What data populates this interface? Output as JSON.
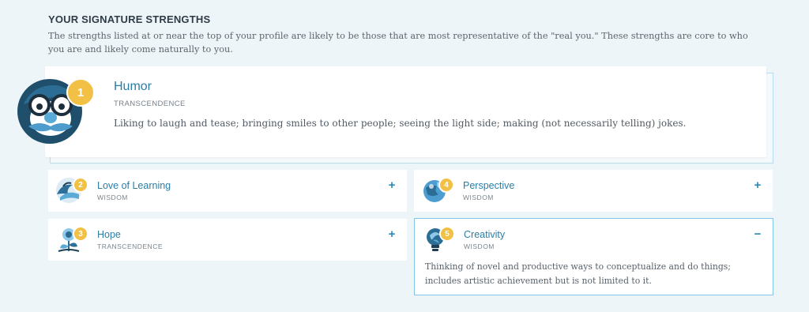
{
  "section": {
    "heading": "YOUR SIGNATURE STRENGTHS",
    "intro": "The strengths listed at or near the top of your profile are likely to be those that are most representative of the \"real you.\" These strengths are core to who you are and likely come naturally to you."
  },
  "featured": {
    "rank": "1",
    "title": "Humor",
    "category": "TRANSCENDENCE",
    "description": "Liking to laugh and tease; bringing smiles to other people; seeing the light side; making (not necessarily telling) jokes.",
    "icon": "glasses-mustache-face-icon"
  },
  "cards": [
    {
      "rank": "2",
      "title": "Love of Learning",
      "category": "WISDOM",
      "toggle": "+",
      "icon": "wave-book-icon"
    },
    {
      "rank": "4",
      "title": "Perspective",
      "category": "WISDOM",
      "toggle": "+",
      "icon": "globe-icon"
    },
    {
      "rank": "3",
      "title": "Hope",
      "category": "TRANSCENDENCE",
      "toggle": "+",
      "icon": "flower-icon"
    },
    {
      "rank": "5",
      "title": "Creativity",
      "category": "WISDOM",
      "toggle": "−",
      "icon": "lightbulb-swirl-icon",
      "description": "Thinking of novel and productive ways to conceptualize and do things; includes artistic achievement but is not limited to it."
    }
  ],
  "colors": {
    "accent": "#2a7ea6",
    "badge": "#f1c045",
    "border": "#84c6e6",
    "background": "#eef5f9"
  }
}
